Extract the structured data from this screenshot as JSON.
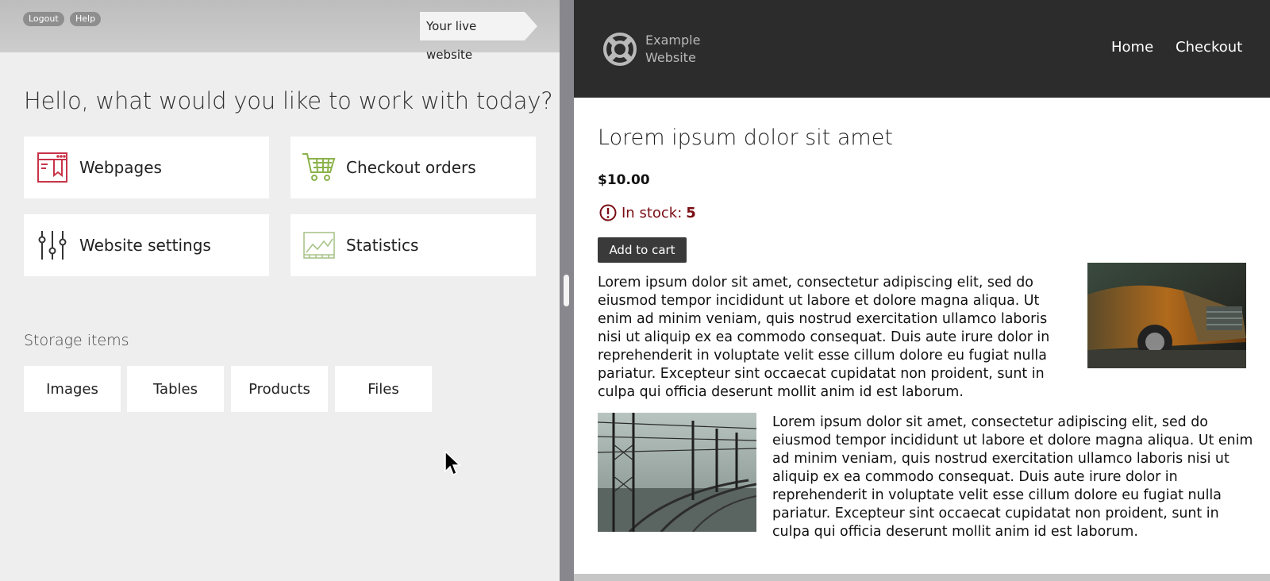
{
  "admin": {
    "top_buttons": {
      "logout": "Logout",
      "help": "Help"
    },
    "live_label": "Your live website",
    "greeting": "Hello, what would you like to work with today?",
    "tiles": [
      {
        "label": "Webpages",
        "icon": "webpage-icon",
        "color": "#c8344a"
      },
      {
        "label": "Checkout orders",
        "icon": "shopping-cart-icon",
        "color": "#8bb24a"
      },
      {
        "label": "Website settings",
        "icon": "sliders-icon",
        "color": "#333333"
      },
      {
        "label": "Statistics",
        "icon": "chart-icon",
        "color": "#a9c48a"
      }
    ],
    "storage": {
      "title": "Storage items",
      "items": [
        "Images",
        "Tables",
        "Products",
        "Files"
      ]
    }
  },
  "site": {
    "logo": {
      "line1": "Example",
      "line2": "Website",
      "icon": "lifebuoy-icon"
    },
    "nav": {
      "home": "Home",
      "checkout": "Checkout"
    },
    "product": {
      "title": "Lorem ipsum dolor sit amet",
      "price": "$10.00",
      "stock_label": "In stock:",
      "stock_qty": "5",
      "add_to_cart": "Add to cart"
    },
    "paragraphs": [
      "Lorem ipsum dolor sit amet, consectetur adipiscing elit, sed do eiusmod tempor incididunt ut labore et dolore magna aliqua. Ut enim ad minim veniam, quis nostrud exercitation ullamco laboris nisi ut aliquip ex ea commodo consequat. Duis aute irure dolor in reprehenderit in voluptate velit esse cillum dolore eu fugiat nulla pariatur. Excepteur sint occaecat cupidatat non proident, sunt in culpa qui officia deserunt mollit anim id est laborum.",
      "Lorem ipsum dolor sit amet, consectetur adipiscing elit, sed do eiusmod tempor incididunt ut labore et dolore magna aliqua. Ut enim ad minim veniam, quis nostrud exercitation ullamco laboris nisi ut aliquip ex ea commodo consequat. Duis aute irure dolor in reprehenderit in voluptate velit esse cillum dolore eu fugiat nulla pariatur. Excepteur sint occaecat cupidatat non proident, sunt in culpa qui officia deserunt mollit anim id est laborum."
    ],
    "stock_color": "#7a0d14"
  }
}
